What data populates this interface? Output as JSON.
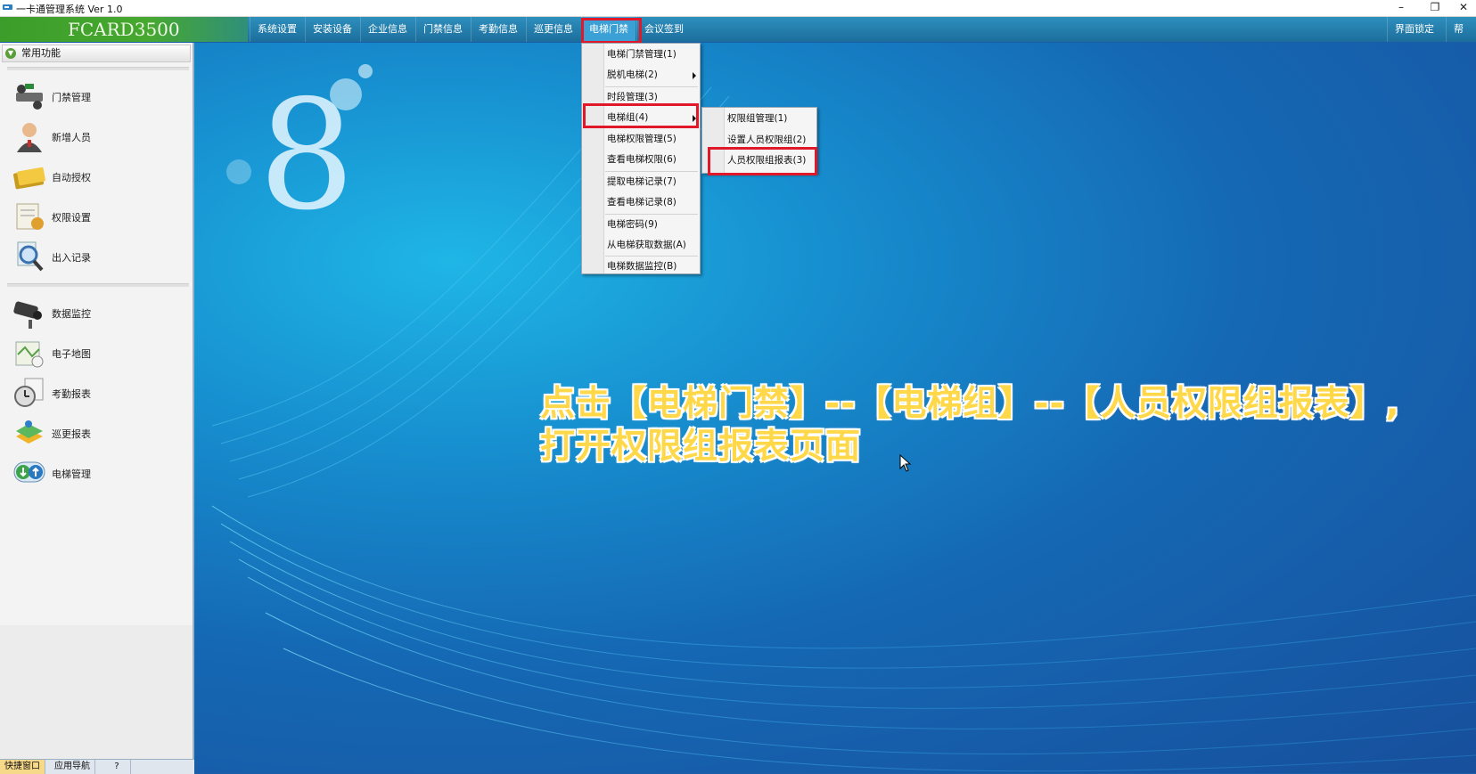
{
  "window": {
    "title": "一卡通管理系统  Ver 1.0",
    "controls": {
      "minimize": "–",
      "restore": "❐",
      "close": "✕"
    }
  },
  "brand": {
    "name": "FCARD3500"
  },
  "menubar": {
    "items": [
      "系统设置",
      "安装设备",
      "企业信息",
      "门禁信息",
      "考勤信息",
      "巡更信息",
      "电梯门禁",
      "会议签到"
    ],
    "active": "电梯门禁",
    "right_items": [
      "界面锁定",
      "帮助"
    ]
  },
  "sidebar": {
    "header": "常用功能",
    "group1": [
      {
        "label": "门禁管理",
        "icon": "access-control-icon"
      },
      {
        "label": "新增人员",
        "icon": "user-add-icon"
      },
      {
        "label": "自动授权",
        "icon": "card-authorize-icon"
      },
      {
        "label": "权限设置",
        "icon": "permission-settings-icon"
      },
      {
        "label": "出入记录",
        "icon": "search-records-icon"
      }
    ],
    "group2": [
      {
        "label": "数据监控",
        "icon": "camera-monitor-icon"
      },
      {
        "label": "电子地图",
        "icon": "map-icon"
      },
      {
        "label": "考勤报表",
        "icon": "clock-report-icon"
      },
      {
        "label": "巡更报表",
        "icon": "patrol-report-icon"
      },
      {
        "label": "电梯管理",
        "icon": "elevator-manage-icon"
      }
    ]
  },
  "bottom_tabs": {
    "items": [
      "快捷窗口",
      "应用导航",
      "?"
    ],
    "active": "快捷窗口"
  },
  "elevator_menu": {
    "items": [
      "电梯门禁管理(1)",
      "脱机电梯(2)",
      "时段管理(3)",
      "电梯组(4)",
      "电梯权限管理(5)",
      "查看电梯权限(6)",
      "提取电梯记录(7)",
      "查看电梯记录(8)",
      "电梯密码(9)",
      "从电梯获取数据(A)",
      "电梯数据监控(B)"
    ],
    "highlighted": "电梯组(4)"
  },
  "elevator_group_submenu": {
    "items": [
      "权限组管理(1)",
      "设置人员权限组(2)",
      "人员权限组报表(3)"
    ],
    "highlighted": "人员权限组报表(3)"
  },
  "annotation": {
    "line1": "点击【电梯门禁】--【电梯组】--【人员权限组报表】,",
    "line2": "打开权限组报表页面"
  },
  "colors": {
    "menubar": "#1c6e9c",
    "brand_bar": "#47a82f",
    "highlight_box": "#e0182a",
    "annotation_text": "#ffd84a",
    "desktop": "#1568b4"
  }
}
